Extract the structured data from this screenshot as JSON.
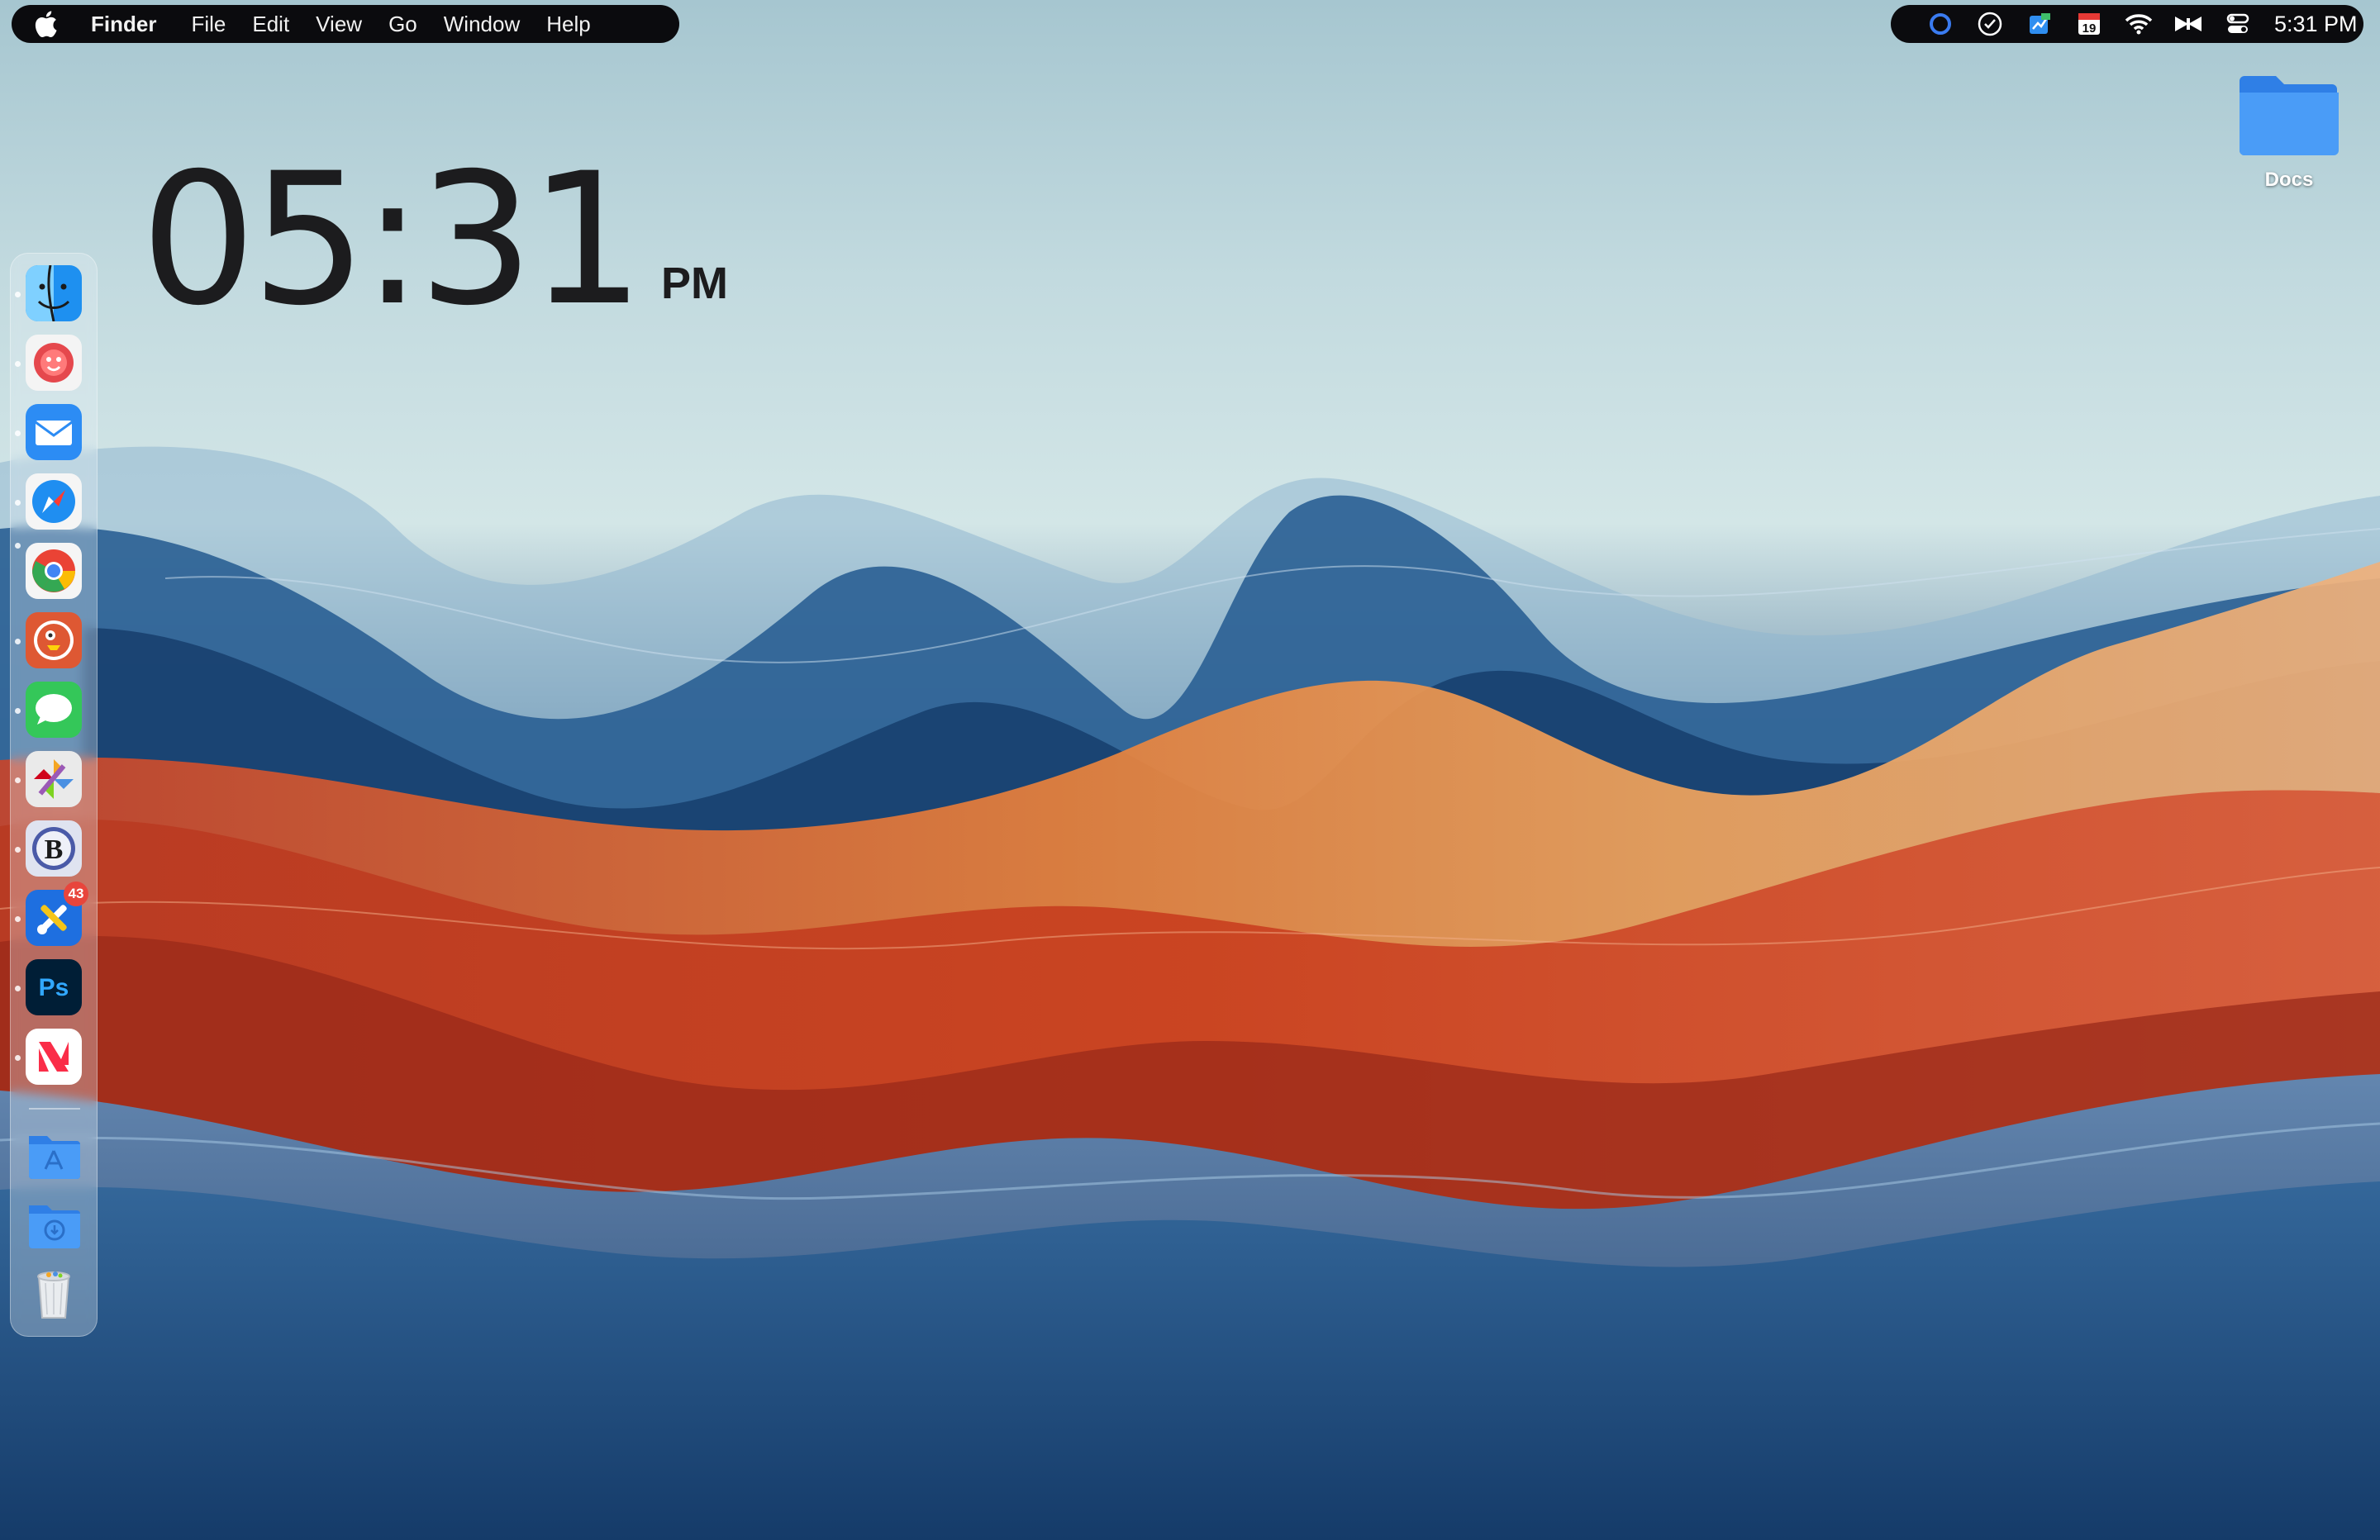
{
  "menubar": {
    "app_name": "Finder",
    "items": [
      "File",
      "Edit",
      "View",
      "Go",
      "Window",
      "Help"
    ],
    "status_icons": [
      "circle-ring-icon",
      "clock-icon",
      "screenshot-icon",
      "calendar-icon",
      "wifi-icon",
      "butterfly-icon",
      "control-center-icon"
    ],
    "calendar_day": "19",
    "clock": "5:31 PM"
  },
  "desktop_clock": {
    "time": "05:31",
    "ampm": "PM"
  },
  "dock": {
    "apps": [
      {
        "name": "finder-icon",
        "running": true
      },
      {
        "name": "flower-app-icon",
        "running": true
      },
      {
        "name": "mail-icon",
        "running": true
      },
      {
        "name": "safari-icon",
        "running": true
      },
      {
        "name": "chrome-icon",
        "running": true
      },
      {
        "name": "duckduckgo-icon",
        "running": true
      },
      {
        "name": "messages-icon",
        "running": true
      },
      {
        "name": "pinwheel-app-icon",
        "running": true
      },
      {
        "name": "bbedit-icon",
        "running": true,
        "letter": "B"
      },
      {
        "name": "xcode-tools-icon",
        "running": true,
        "badge": "43"
      },
      {
        "name": "photoshop-icon",
        "running": true,
        "letter": "Ps"
      },
      {
        "name": "news-icon",
        "running": true
      }
    ],
    "folders": [
      "applications-folder-icon",
      "downloads-folder-icon",
      "trash-icon"
    ]
  },
  "desktop_items": {
    "folder_label": "Docs"
  },
  "colors": {
    "menubar_bg": "#0b0b0e",
    "folder_blue": "#3f8ef0",
    "badge_red": "#e8453c"
  }
}
